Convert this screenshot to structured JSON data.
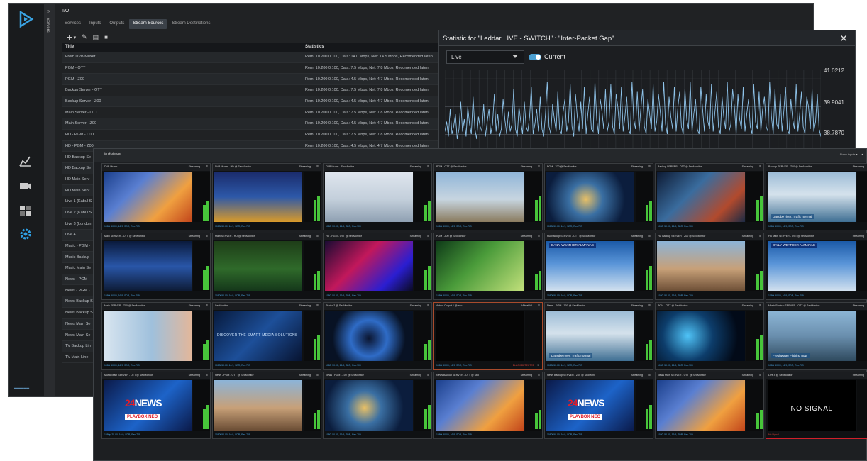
{
  "io_window": {
    "title": "I/O",
    "sidebar_label": "Servers",
    "tabs": [
      "Services",
      "Inputs",
      "Outputs",
      "Stream Sources",
      "Stream Destinations"
    ],
    "active_tab": "Stream Sources",
    "toolbar": {
      "add": "+",
      "dropdown": "▾",
      "edit": "✎",
      "doc": "▤",
      "delete": "🗑"
    },
    "table": {
      "headers": [
        "Title",
        "Statistics"
      ],
      "rows": [
        {
          "title": "From DVB Muxer",
          "stats": "Rem: 10.200.0.100, Data: 14.0 Mbps, Net: 14.5 Mbps, Recomended laten"
        },
        {
          "title": "PGM - OTT",
          "stats": "Rem: 10.200.0.100, Data: 7.5 Mbps, Net: 7.8 Mbps, Recomended laten"
        },
        {
          "title": "PGM - Z00",
          "stats": "Rem: 10.200.0.100, Data: 4.5 Mbps, Net: 4.7 Mbps, Recomended laten"
        },
        {
          "title": "Backup Server - OTT",
          "stats": "Rem: 10.200.0.100, Data: 7.5 Mbps, Net: 7.8 Mbps, Recomended laten"
        },
        {
          "title": "Backup Server - Z00",
          "stats": "Rem: 10.200.0.100, Data: 4.5 Mbps, Net: 4.7 Mbps, Recomended laten"
        },
        {
          "title": "Main Server - OTT",
          "stats": "Rem: 10.200.0.100, Data: 7.5 Mbps, Net: 7.8 Mbps, Recomended laten"
        },
        {
          "title": "Main Server - Z00",
          "stats": "Rem: 10.200.0.100, Data: 4.5 Mbps, Net: 4.7 Mbps, Recomended laten"
        },
        {
          "title": "HD - PGM - OTT",
          "stats": "Rem: 10.200.0.100, Data: 7.5 Mbps, Net: 7.8 Mbps, Recomended laten"
        },
        {
          "title": "HD - PGM - Z00",
          "stats": "Rem: 10.200.0.100, Data: 4.5 Mbps, Net: 4.7 Mbps, Recomended laten"
        },
        {
          "title": "HD Backup Se",
          "stats": ""
        },
        {
          "title": "HD Backup Se",
          "stats": ""
        },
        {
          "title": "HD Main Serv",
          "stats": ""
        },
        {
          "title": "HD Main Serv",
          "stats": ""
        },
        {
          "title": "Live 1 (Kabul S",
          "stats": ""
        },
        {
          "title": "Live 2 (Kabul S",
          "stats": ""
        },
        {
          "title": "Live 3 (London",
          "stats": ""
        },
        {
          "title": "Live 4",
          "stats": ""
        },
        {
          "title": "Music - PGM -",
          "stats": ""
        },
        {
          "title": "Music Backup",
          "stats": ""
        },
        {
          "title": "Music Main Se",
          "stats": ""
        },
        {
          "title": "News - PGM -",
          "stats": ""
        },
        {
          "title": "News - PGM -",
          "stats": ""
        },
        {
          "title": "News Backup S",
          "stats": ""
        },
        {
          "title": "News Backup S",
          "stats": ""
        },
        {
          "title": "News Main Se",
          "stats": ""
        },
        {
          "title": "News Main Se",
          "stats": ""
        },
        {
          "title": "TV Backup Lin",
          "stats": ""
        },
        {
          "title": "TV Main Line",
          "stats": ""
        }
      ]
    }
  },
  "stat_window": {
    "title": "Statistic for \"Leddar LIVE - SWITCH\" : \"Inter-Packet Gap\"",
    "close": "✕",
    "select_value": "Live",
    "toggle_label": "Current",
    "toggle_on": true,
    "y_labels": [
      "41.0212",
      "39.9041",
      "38.7870"
    ],
    "line_color": "#8ec3ea"
  },
  "chart_data": {
    "type": "line",
    "title": "",
    "ylim": [
      38.2,
      41.4
    ],
    "yticks": [
      41.0212,
      39.9041,
      38.787
    ],
    "series": [
      {
        "values": [
          38.9,
          39.3,
          38.7,
          39.8,
          38.8,
          39.1,
          39.6,
          38.6,
          39.0,
          40.1,
          38.9,
          39.4,
          38.7,
          39.9,
          39.2,
          38.8,
          40.3,
          39.0,
          38.6,
          39.5,
          39.1,
          38.9,
          40.0,
          38.7,
          39.3,
          39.8,
          38.8,
          39.2,
          40.4,
          38.9,
          39.6,
          38.7,
          39.0,
          40.2,
          39.4,
          38.8,
          39.7,
          38.9,
          39.2,
          40.6,
          39.0,
          38.7,
          39.9,
          39.3,
          38.8,
          40.1,
          39.1,
          38.9,
          39.5,
          40.7,
          38.8,
          39.2,
          39.8,
          38.9,
          40.3,
          39.0,
          38.7,
          39.6,
          40.9,
          39.1,
          38.8,
          40.0,
          39.4,
          38.9,
          40.5,
          39.0,
          38.8,
          39.7,
          40.2,
          38.9,
          39.3,
          40.8,
          39.1,
          38.7,
          40.4,
          39.5,
          38.9,
          40.1,
          39.0,
          40.7,
          38.8,
          39.6,
          40.3,
          39.0,
          38.9,
          40.9,
          39.4,
          38.8,
          40.2,
          39.7,
          39.0,
          40.6,
          38.9,
          39.3,
          40.8,
          39.1,
          38.8,
          40.4,
          39.9,
          39.0,
          40.7,
          38.9,
          39.5,
          40.3,
          39.0,
          38.8,
          40.9,
          39.4,
          39.0,
          40.5,
          38.9,
          39.8,
          40.6,
          39.1,
          38.8,
          40.2,
          39.6,
          39.0,
          40.8,
          38.9,
          39.3,
          40.4,
          39.7,
          38.9,
          40.9,
          39.2,
          38.8,
          40.3,
          39.5,
          39.0,
          40.7,
          38.9,
          39.9,
          40.5,
          39.1,
          38.8,
          40.6,
          39.4,
          39.0,
          40.9,
          38.9,
          39.6,
          40.2,
          39.0,
          38.8,
          40.7,
          39.8,
          38.9,
          40.4,
          39.3,
          39.0,
          40.8,
          38.9,
          39.7,
          40.5,
          39.1,
          38.8,
          40.3,
          39.5,
          39.0,
          40.9,
          38.9,
          39.2,
          40.6,
          39.9,
          38.8,
          40.4,
          39.4,
          39.0,
          40.7,
          38.9,
          39.6,
          40.2,
          39.1,
          38.8,
          40.8,
          39.3,
          39.0,
          40.5,
          38.9,
          39.8,
          40.3,
          39.1,
          38.9,
          40.9,
          39.5,
          38.8,
          40.6,
          39.2,
          39.0,
          40.4,
          38.9,
          39.7,
          40.7,
          39.0,
          38.8,
          40.2,
          39.4,
          39.0,
          40.8,
          38.9,
          39.6,
          40.5,
          39.1,
          38.8,
          40.3,
          39.9,
          39.0,
          40.6,
          38.9,
          39.3,
          40.4,
          39.0,
          38.7
        ]
      }
    ]
  },
  "multiviewer": {
    "title": "Multiviewer",
    "header_controls": [
      "Show inputs ▾",
      "■"
    ],
    "tiles": [
      {
        "title": "DVB Muxer",
        "status": "Streaming",
        "foot": "1080i 50.00, 16:9, SDR, Rec.709",
        "scene": "sky"
      },
      {
        "title": "DVB Muxer - HD @ SeoMonitor",
        "status": "Streaming",
        "foot": "1080i 50.00, 16:9, SDR, Rec.709",
        "scene": "news-studio"
      },
      {
        "title": "DVB Muxer - SeoMonitor",
        "status": "Streaming",
        "foot": "1080i 50.00, 16:9, SDR, Rec.709",
        "scene": "hockey"
      },
      {
        "title": "PGM - OTT @ SeoMonitor",
        "status": "Streaming",
        "foot": "1080i 50.00, 16:9, SDR, Rec.709",
        "scene": "london"
      },
      {
        "title": "PGM - Z00 @ SeoMonitor",
        "status": "Streaming",
        "foot": "1080i 50.00, 16:9, SDR, Rec.709",
        "scene": "globe"
      },
      {
        "title": "Backup SERVER - OTT @ SeoMonitor",
        "status": "Streaming",
        "foot": "1080i 50.00, 16:9, SDR, Rec.709",
        "scene": "robot"
      },
      {
        "title": "Backup SERVER - Z00 @ SeoMonitor",
        "status": "Streaming",
        "foot": "1080i 50.00, 16:9, SDR, Rec.709",
        "scene": "ship",
        "caption": "Danube river: Trafic normal"
      },
      {
        "title": "Main SERVER - OTT @ SeoMonitor",
        "status": "Streaming",
        "foot": "1080i 50.00, 16:9, SDR, Rec.709",
        "scene": "ring"
      },
      {
        "title": "Main SERVER - HD @ SeoMonitor",
        "status": "Streaming",
        "foot": "1080i 50.00, 16:9, SDR, Rec.709",
        "scene": "football"
      },
      {
        "title": "HD - PGM - OTT @ SeoMonitor",
        "status": "Streaming",
        "foot": "1080i 50.00, 16:9, SDR, Rec.709",
        "scene": "neon"
      },
      {
        "title": "PGM - Z00 @ SeoMonitor",
        "status": "Streaming",
        "foot": "1080i 50.00, 16:9, SDR, Rec.709",
        "scene": "dragonfly"
      },
      {
        "title": "HD Backup SERVER - OTT @ SeoMonitor",
        "status": "Streaming",
        "foot": "1080i 50.00, 16:9, SDR, Rec.709",
        "scene": "weather",
        "caption": "DAILY WEATHER ALMANAC"
      },
      {
        "title": "HD Backup SERVER - Z00 @ SeoMonitor",
        "status": "Streaming",
        "foot": "1080i 50.00, 16:9, SDR, Rec.709",
        "scene": "town"
      },
      {
        "title": "HD Main SERVER - OTT @ SeoMonitor",
        "status": "Streaming",
        "foot": "1080i 50.00, 16:9, SDR, Rec.709",
        "scene": "weather",
        "caption": "DAILY WEATHER ALMANAC"
      },
      {
        "title": "Main SERVER - Z00 @ SeoMonitor",
        "status": "Streaming",
        "foot": "1080i 50.00, 16:9, SDR, Rec.709",
        "scene": "presenter"
      },
      {
        "title": "SeoMonitor",
        "status": "Streaming",
        "foot": "1080i 50.00, 16:9, SDR, Rec.709",
        "scene": "discover",
        "caption": "DISCOVER THE SMART MEDIA SOLUTIONS"
      },
      {
        "title": "Studio 2 @ SeoMonitor",
        "status": "Streaming",
        "foot": "1080i 50.00, 16:9, SDR, Rec.709",
        "scene": "speaker"
      },
      {
        "title": "Airbox Output 1 @ seo",
        "status": "Virtual IO",
        "foot": "1080i 50.00, 16:9, SDR, Rec.709",
        "scene": "black",
        "alert": "BLACK DETECTED",
        "alert_count": "+3"
      },
      {
        "title": "News - PGM - Z00 @ SeoMonitor",
        "status": "Streaming",
        "foot": "1080i 50.00, 16:9, SDR, Rec.709",
        "scene": "ship",
        "caption": "Danube river: Trafic normal"
      },
      {
        "title": "PGM - OTT @ SeoMonitor",
        "status": "Streaming",
        "foot": "1080i 50.00, 16:9, SDR, Rec.709",
        "scene": "network"
      },
      {
        "title": "Music Backup SERVER - OTT @ SeoMonitor",
        "status": "Streaming",
        "foot": "1080i 50.00, 16:9, SDR, Rec.709",
        "scene": "fisher",
        "caption": "Freshwater Fishing now"
      },
      {
        "title": "Music Main SERVER - OTT @ SeoMonitor",
        "status": "Streaming",
        "foot": "1080p 25.00, 16:9, SDR, Rec.709",
        "scene": "news24"
      },
      {
        "title": "News - PGM - OTT @ SeoMonitor",
        "status": "Streaming",
        "foot": "1080i 50.00, 16:9, SDR, Rec.709",
        "scene": "town"
      },
      {
        "title": "News - PGM - Z00 @ SeoMonitor",
        "status": "Streaming",
        "foot": "1080i 50.00, 16:9, SDR, Rec.709",
        "scene": "globe"
      },
      {
        "title": "News Backup SERVER - OTT @ Seo",
        "status": "Streaming",
        "foot": "1080i 50.00, 16:9, SDR, Rec.709",
        "scene": "sky"
      },
      {
        "title": "News Backup SERVER - Z00 @ SeoMonit",
        "status": "Streaming",
        "foot": "1080i 50.00, 16:9, SDR, Rec.709",
        "scene": "news24"
      },
      {
        "title": "News Main SERVER - OTT @ SeoMonitor",
        "status": "Streaming",
        "foot": "1080i 50.00, 16:9, SDR, Rec.709",
        "scene": "sky"
      },
      {
        "title": "Live 4 @ SeoMonitor",
        "status": "Streaming",
        "foot": "No Signal",
        "scene": "nosignal",
        "caption": "NO SIGNAL"
      }
    ],
    "news_logo": {
      "number": "24",
      "word": "NEWS",
      "sub": "PLAYBOX NEO"
    }
  },
  "colors": {
    "accent": "#4a9fd1",
    "meter_green": "#47c53a",
    "alert_red": "#e0443a",
    "window_bg": "#202224"
  }
}
